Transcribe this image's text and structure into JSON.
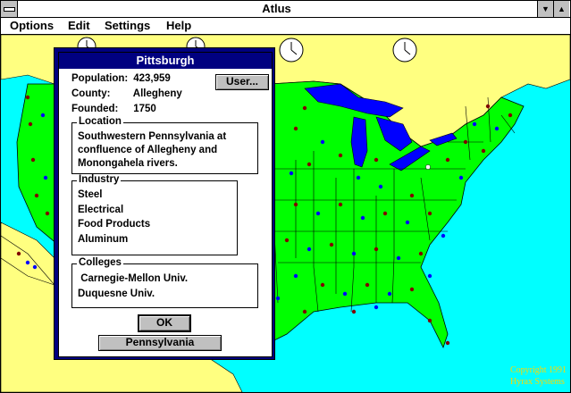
{
  "window": {
    "title": "Atlus"
  },
  "menu": [
    {
      "label": "Options",
      "accel": "O"
    },
    {
      "label": "Edit",
      "accel": "E"
    },
    {
      "label": "Settings",
      "accel": "S"
    },
    {
      "label": "Help",
      "accel": "H"
    }
  ],
  "dialog": {
    "title": "Pittsburgh",
    "population_label": "Population:",
    "population_value": "423,959",
    "county_label": "County:",
    "county_value": "Allegheny",
    "founded_label": "Founded:",
    "founded_value": "1750",
    "user_button": "User...",
    "location_title": "Location",
    "location_text": "Southwestern Pennsylvania at confluence of Allegheny and Monongahela rivers.",
    "industry_title": "Industry",
    "industries": [
      "Steel",
      "Electrical",
      "Food Products",
      "Aluminum"
    ],
    "colleges_title": "Colleges",
    "colleges": [
      " Carnegie-Mellon Univ.",
      "Duquesne Univ."
    ],
    "ok_button": "OK",
    "state_button": "Pennsylvania"
  },
  "footer": {
    "copyright_line1": "Copyright 1991",
    "copyright_line2": "Hyrax Systems"
  },
  "colors": {
    "ocean": "#00ffff",
    "land_us": "#00ff00",
    "land_foreign": "#ffff80",
    "water": "#0000ff",
    "dialog_accent": "#000080"
  },
  "icons": [
    "clock-icon",
    "city-dot-icon"
  ]
}
